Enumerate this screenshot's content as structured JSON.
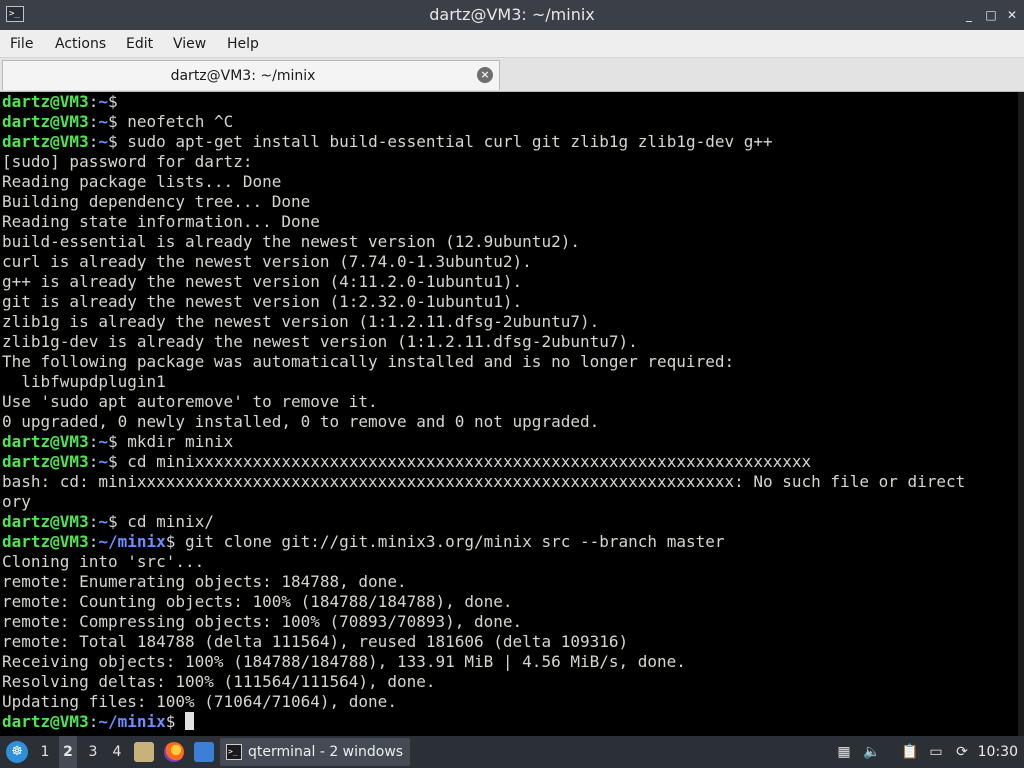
{
  "window": {
    "title": "dartz@VM3: ~/minix",
    "controls": {
      "minimize": "_",
      "maximize": "□",
      "close": "✕"
    }
  },
  "menu": {
    "file": "File",
    "actions": "Actions",
    "edit": "Edit",
    "view": "View",
    "help": "Help"
  },
  "tab": {
    "label": "dartz@VM3: ~/minix",
    "close_icon": "close-icon"
  },
  "terminal": {
    "colors": {
      "background": "#000000",
      "text": "#d3d7cf",
      "prompt_user": "#4ee64e",
      "prompt_path": "#6f8dff"
    },
    "lines": [
      {
        "user": "dartz@VM3",
        "path": "~",
        "cmd": ""
      },
      {
        "user": "dartz@VM3",
        "path": "~",
        "cmd": " neofetch ^C"
      },
      {
        "user": "dartz@VM3",
        "path": "~",
        "cmd": " sudo apt-get install build-essential curl git zlib1g zlib1g-dev g++"
      },
      {
        "text": "[sudo] password for dartz:"
      },
      {
        "text": "Reading package lists... Done"
      },
      {
        "text": "Building dependency tree... Done"
      },
      {
        "text": "Reading state information... Done"
      },
      {
        "text": "build-essential is already the newest version (12.9ubuntu2)."
      },
      {
        "text": "curl is already the newest version (7.74.0-1.3ubuntu2)."
      },
      {
        "text": "g++ is already the newest version (4:11.2.0-1ubuntu1)."
      },
      {
        "text": "git is already the newest version (1:2.32.0-1ubuntu1)."
      },
      {
        "text": "zlib1g is already the newest version (1:1.2.11.dfsg-2ubuntu7)."
      },
      {
        "text": "zlib1g-dev is already the newest version (1:1.2.11.dfsg-2ubuntu7)."
      },
      {
        "text": "The following package was automatically installed and is no longer required:"
      },
      {
        "text": "  libfwupdplugin1"
      },
      {
        "text": "Use 'sudo apt autoremove' to remove it."
      },
      {
        "text": "0 upgraded, 0 newly installed, 0 to remove and 0 not upgraded."
      },
      {
        "user": "dartz@VM3",
        "path": "~",
        "cmd": " mkdir minix"
      },
      {
        "user": "dartz@VM3",
        "path": "~",
        "cmd": " cd minixxxxxxxxxxxxxxxxxxxxxxxxxxxxxxxxxxxxxxxxxxxxxxxxxxxxxxxxxxxxxxxx"
      },
      {
        "text": "bash: cd: minixxxxxxxxxxxxxxxxxxxxxxxxxxxxxxxxxxxxxxxxxxxxxxxxxxxxxxxxxxxxxx: No such file or direct"
      },
      {
        "text": "ory"
      },
      {
        "user": "dartz@VM3",
        "path": "~",
        "cmd": " cd minix/"
      },
      {
        "user": "dartz@VM3",
        "path": "~/minix",
        "cmd": " git clone git://git.minix3.org/minix src --branch master"
      },
      {
        "text": "Cloning into 'src'..."
      },
      {
        "text": "remote: Enumerating objects: 184788, done."
      },
      {
        "text": "remote: Counting objects: 100% (184788/184788), done."
      },
      {
        "text": "remote: Compressing objects: 100% (70893/70893), done."
      },
      {
        "text": "remote: Total 184788 (delta 111564), reused 181606 (delta 109316)"
      },
      {
        "text": "Receiving objects: 100% (184788/184788), 133.91 MiB | 4.56 MiB/s, done."
      },
      {
        "text": "Resolving deltas: 100% (111564/111564), done."
      },
      {
        "text": "Updating files: 100% (71064/71064), done."
      },
      {
        "user": "dartz@VM3",
        "path": "~/minix",
        "cmd": " ",
        "cursor": true
      }
    ]
  },
  "taskbar": {
    "workspaces": [
      "1",
      "2",
      "3",
      "4"
    ],
    "active_workspace": "2",
    "launchers": [
      "file-manager-icon",
      "firefox-icon",
      "show-desktop-icon"
    ],
    "task_label": "qterminal - 2 windows",
    "tray": [
      "chat-icon",
      "volume-icon",
      "clipboard-icon",
      "network-icon",
      "update-icon"
    ],
    "clock": "10:30"
  }
}
